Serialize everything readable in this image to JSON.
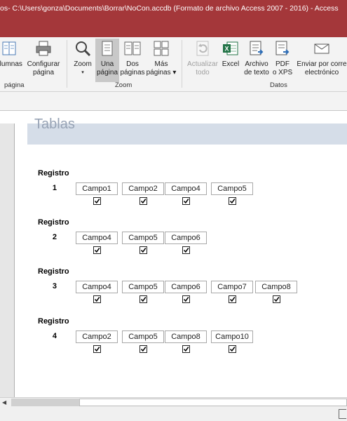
{
  "window_title": "os- C:\\Users\\gonza\\Documents\\Borrar\\NoCon.accdb (Formato de archivo Access 2007 - 2016)  -  Access",
  "ribbon": {
    "buttons": {
      "columnas": {
        "line1": "olumnas",
        "line2": ""
      },
      "configurar": {
        "line1": "Configurar",
        "line2": "página"
      },
      "zoom": {
        "line1": "Zoom",
        "line2": "▾"
      },
      "una": {
        "line1": "Una",
        "line2": "página"
      },
      "dos": {
        "line1": "Dos",
        "line2": "páginas"
      },
      "mas": {
        "line1": "Más",
        "line2": "páginas ▾"
      },
      "actualizar": {
        "line1": "Actualizar",
        "line2": "todo"
      },
      "excel": {
        "line1": "Excel",
        "line2": ""
      },
      "archivo": {
        "line1": "Archivo",
        "line2": "de texto"
      },
      "pdf": {
        "line1": "PDF",
        "line2": "o XPS"
      },
      "enviar": {
        "line1": "Enviar por corre",
        "line2": "electrónico"
      }
    },
    "groups": {
      "pagina": "página",
      "zoom": "Zoom",
      "datos": "Datos"
    }
  },
  "report": {
    "header_title": "Tablas",
    "records": [
      {
        "label": "Registro",
        "number": "1",
        "fields": [
          "Campo1",
          "Campo2",
          "Campo4",
          "Campo5"
        ]
      },
      {
        "label": "Registro",
        "number": "2",
        "fields": [
          "Campo4",
          "Campo5",
          "Campo6"
        ]
      },
      {
        "label": "Registro",
        "number": "3",
        "fields": [
          "Campo4",
          "Campo5",
          "Campo6",
          "Campo7",
          "Campo8"
        ]
      },
      {
        "label": "Registro",
        "number": "4",
        "fields": [
          "Campo2",
          "Campo5",
          "Campo8",
          "Campo10"
        ]
      }
    ]
  },
  "colors": {
    "title_bar": "#a4373a",
    "ribbon": "#f3f3f3",
    "header_band": "#d5dde8"
  }
}
